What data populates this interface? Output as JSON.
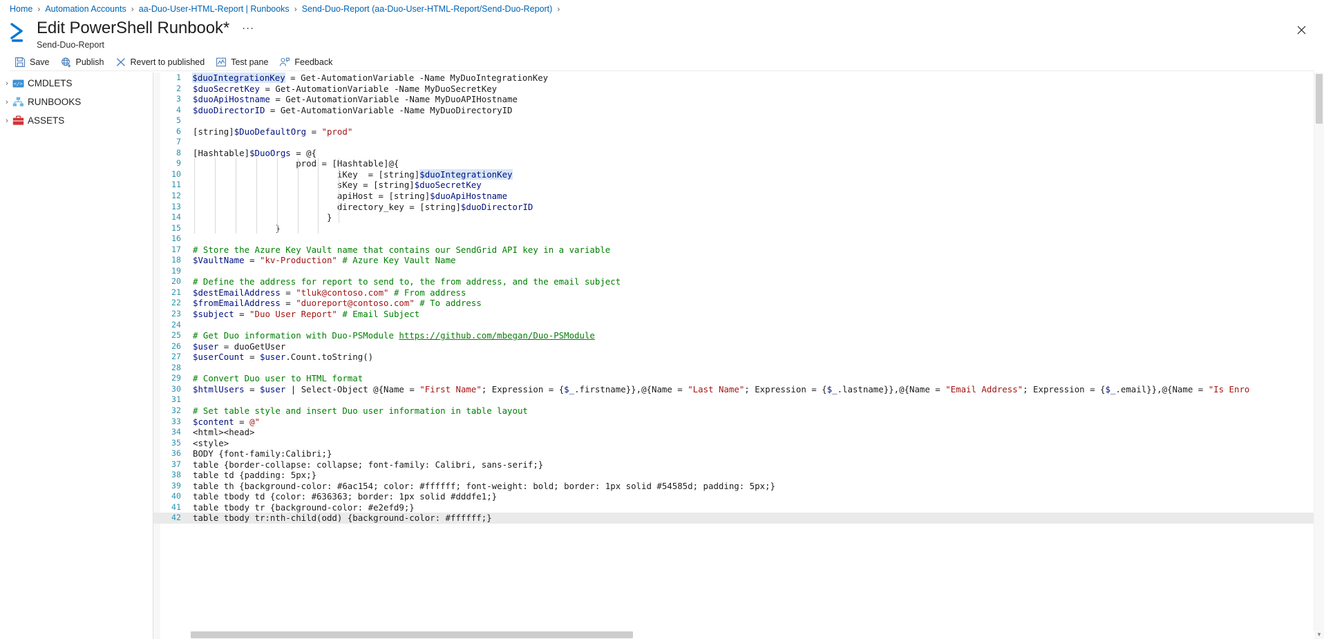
{
  "breadcrumb": {
    "items": [
      {
        "label": "Home",
        "type": "link"
      },
      {
        "label": "Automation Accounts",
        "type": "link"
      },
      {
        "label": "aa-Duo-User-HTML-Report | Runbooks",
        "type": "link"
      },
      {
        "label": "Send-Duo-Report (aa-Duo-User-HTML-Report/Send-Duo-Report)",
        "type": "link"
      }
    ],
    "separator": "›"
  },
  "header": {
    "title": "Edit PowerShell Runbook*",
    "subtitle": "Send-Duo-Report",
    "more_label": "···",
    "close_icon": "close-icon",
    "logo_icon": "powershell-runbook-icon"
  },
  "commandbar": {
    "items": [
      {
        "label": "Save",
        "icon": "save-icon"
      },
      {
        "label": "Publish",
        "icon": "publish-globe-icon"
      },
      {
        "label": "Revert to published",
        "icon": "revert-x-icon"
      },
      {
        "label": "Test pane",
        "icon": "test-pane-icon"
      },
      {
        "label": "Feedback",
        "icon": "feedback-person-icon"
      }
    ]
  },
  "tree": {
    "items": [
      {
        "label": "CMDLETS",
        "icon": "code-brackets-icon",
        "expanded": false,
        "chevron": "›"
      },
      {
        "label": "RUNBOOKS",
        "icon": "hierarchy-icon",
        "expanded": false,
        "chevron": "›"
      },
      {
        "label": "ASSETS",
        "icon": "briefcase-icon",
        "expanded": false,
        "chevron": "›"
      }
    ]
  },
  "editor": {
    "current_line": 42,
    "cursor_line": 1,
    "selection_text": "$duoIntegrationKey",
    "lines": [
      {
        "n": 1,
        "tokens": [
          {
            "t": "var",
            "v": "$duoIntegrationKey",
            "sel": true,
            "caret": true
          },
          {
            "t": "plain",
            "v": " = Get-AutomationVariable -Name MyDuoIntegrationKey"
          }
        ]
      },
      {
        "n": 2,
        "tokens": [
          {
            "t": "var",
            "v": "$duoSecretKey"
          },
          {
            "t": "plain",
            "v": " = Get-AutomationVariable -Name MyDuoSecretKey"
          }
        ]
      },
      {
        "n": 3,
        "tokens": [
          {
            "t": "var",
            "v": "$duoApiHostname"
          },
          {
            "t": "plain",
            "v": " = Get-AutomationVariable -Name MyDuoAPIHostname"
          }
        ]
      },
      {
        "n": 4,
        "tokens": [
          {
            "t": "var",
            "v": "$duoDirectorID"
          },
          {
            "t": "plain",
            "v": " = Get-AutomationVariable -Name MyDuoDirectoryID"
          }
        ]
      },
      {
        "n": 5,
        "tokens": []
      },
      {
        "n": 6,
        "tokens": [
          {
            "t": "plain",
            "v": "[string]"
          },
          {
            "t": "var",
            "v": "$DuoDefaultOrg"
          },
          {
            "t": "plain",
            "v": " = "
          },
          {
            "t": "str",
            "v": "\"prod\""
          }
        ]
      },
      {
        "n": 7,
        "tokens": []
      },
      {
        "n": 8,
        "tokens": [
          {
            "t": "plain",
            "v": "[Hashtable]"
          },
          {
            "t": "var",
            "v": "$DuoOrgs"
          },
          {
            "t": "plain",
            "v": " = @{"
          }
        ]
      },
      {
        "n": 9,
        "tokens": [
          {
            "t": "plain",
            "v": "                    prod = [Hashtable]@{"
          }
        ]
      },
      {
        "n": 10,
        "tokens": [
          {
            "t": "plain",
            "v": "                            iKey  = [string]"
          },
          {
            "t": "var",
            "v": "$duoIntegrationKey",
            "sel": true
          }
        ]
      },
      {
        "n": 11,
        "tokens": [
          {
            "t": "plain",
            "v": "                            sKey = [string]"
          },
          {
            "t": "var",
            "v": "$duoSecretKey"
          }
        ]
      },
      {
        "n": 12,
        "tokens": [
          {
            "t": "plain",
            "v": "                            apiHost = [string]"
          },
          {
            "t": "var",
            "v": "$duoApiHostname"
          }
        ]
      },
      {
        "n": 13,
        "tokens": [
          {
            "t": "plain",
            "v": "                            directory_key = [string]"
          },
          {
            "t": "var",
            "v": "$duoDirectorID"
          }
        ]
      },
      {
        "n": 14,
        "tokens": [
          {
            "t": "plain",
            "v": "                          }"
          }
        ]
      },
      {
        "n": 15,
        "tokens": [
          {
            "t": "plain",
            "v": "                }"
          }
        ]
      },
      {
        "n": 16,
        "tokens": []
      },
      {
        "n": 17,
        "tokens": [
          {
            "t": "com",
            "v": "# Store the Azure Key Vault name that contains our SendGrid API key in a variable"
          }
        ]
      },
      {
        "n": 18,
        "tokens": [
          {
            "t": "var",
            "v": "$VaultName"
          },
          {
            "t": "plain",
            "v": " = "
          },
          {
            "t": "str",
            "v": "\"kv-Production\""
          },
          {
            "t": "plain",
            "v": " "
          },
          {
            "t": "com",
            "v": "# Azure Key Vault Name"
          }
        ]
      },
      {
        "n": 19,
        "tokens": []
      },
      {
        "n": 20,
        "tokens": [
          {
            "t": "com",
            "v": "# Define the address for report to send to, the from address, and the email subject"
          }
        ]
      },
      {
        "n": 21,
        "tokens": [
          {
            "t": "var",
            "v": "$destEmailAddress"
          },
          {
            "t": "plain",
            "v": " = "
          },
          {
            "t": "str",
            "v": "\"tluk@contoso.com\""
          },
          {
            "t": "plain",
            "v": " "
          },
          {
            "t": "com",
            "v": "# From address"
          }
        ]
      },
      {
        "n": 22,
        "tokens": [
          {
            "t": "var",
            "v": "$fromEmailAddress"
          },
          {
            "t": "plain",
            "v": " = "
          },
          {
            "t": "str",
            "v": "\"duoreport@contoso.com\""
          },
          {
            "t": "plain",
            "v": " "
          },
          {
            "t": "com",
            "v": "# To address"
          }
        ]
      },
      {
        "n": 23,
        "tokens": [
          {
            "t": "var",
            "v": "$subject"
          },
          {
            "t": "plain",
            "v": " = "
          },
          {
            "t": "str",
            "v": "\"Duo User Report\""
          },
          {
            "t": "plain",
            "v": " "
          },
          {
            "t": "com",
            "v": "# Email Subject"
          }
        ]
      },
      {
        "n": 24,
        "tokens": []
      },
      {
        "n": 25,
        "tokens": [
          {
            "t": "com",
            "v": "# Get Duo information with Duo-PSModule "
          },
          {
            "t": "url",
            "v": "https://github.com/mbegan/Duo-PSModule"
          }
        ]
      },
      {
        "n": 26,
        "tokens": [
          {
            "t": "var",
            "v": "$user"
          },
          {
            "t": "plain",
            "v": " = duoGetUser"
          }
        ]
      },
      {
        "n": 27,
        "tokens": [
          {
            "t": "var",
            "v": "$userCount"
          },
          {
            "t": "plain",
            "v": " = "
          },
          {
            "t": "var",
            "v": "$user"
          },
          {
            "t": "plain",
            "v": ".Count.toString()"
          }
        ]
      },
      {
        "n": 28,
        "tokens": []
      },
      {
        "n": 29,
        "tokens": [
          {
            "t": "com",
            "v": "# Convert Duo user to HTML format"
          }
        ]
      },
      {
        "n": 30,
        "tokens": [
          {
            "t": "var",
            "v": "$htmlUsers"
          },
          {
            "t": "plain",
            "v": " = "
          },
          {
            "t": "var",
            "v": "$user"
          },
          {
            "t": "plain",
            "v": " | Select-Object @{Name = "
          },
          {
            "t": "str",
            "v": "\"First Name\""
          },
          {
            "t": "plain",
            "v": "; Expression = {"
          },
          {
            "t": "var",
            "v": "$_"
          },
          {
            "t": "plain",
            "v": ".firstname}},@{Name = "
          },
          {
            "t": "str",
            "v": "\"Last Name\""
          },
          {
            "t": "plain",
            "v": "; Expression = {"
          },
          {
            "t": "var",
            "v": "$_"
          },
          {
            "t": "plain",
            "v": ".lastname}},@{Name = "
          },
          {
            "t": "str",
            "v": "\"Email Address\""
          },
          {
            "t": "plain",
            "v": "; Expression = {"
          },
          {
            "t": "var",
            "v": "$_"
          },
          {
            "t": "plain",
            "v": ".email}},@{Name = "
          },
          {
            "t": "str",
            "v": "\"Is Enro"
          }
        ]
      },
      {
        "n": 31,
        "tokens": []
      },
      {
        "n": 32,
        "tokens": [
          {
            "t": "com",
            "v": "# Set table style and insert Duo user information in table layout"
          }
        ]
      },
      {
        "n": 33,
        "tokens": [
          {
            "t": "var",
            "v": "$content"
          },
          {
            "t": "plain",
            "v": " = "
          },
          {
            "t": "str",
            "v": "@\""
          }
        ]
      },
      {
        "n": 34,
        "tokens": [
          {
            "t": "plain",
            "v": "<html><head>"
          }
        ]
      },
      {
        "n": 35,
        "tokens": [
          {
            "t": "plain",
            "v": "<style>"
          }
        ]
      },
      {
        "n": 36,
        "tokens": [
          {
            "t": "plain",
            "v": "BODY {font-family:Calibri;}"
          }
        ]
      },
      {
        "n": 37,
        "tokens": [
          {
            "t": "plain",
            "v": "table {border-collapse: collapse; font-family: Calibri, sans-serif;}"
          }
        ]
      },
      {
        "n": 38,
        "tokens": [
          {
            "t": "plain",
            "v": "table td {padding: 5px;}"
          }
        ]
      },
      {
        "n": 39,
        "tokens": [
          {
            "t": "plain",
            "v": "table th {background-color: #6ac154; color: #ffffff; font-weight: bold; border: 1px solid #54585d; padding: 5px;}"
          }
        ]
      },
      {
        "n": 40,
        "tokens": [
          {
            "t": "plain",
            "v": "table tbody td {color: #636363; border: 1px solid #dddfe1;}"
          }
        ]
      },
      {
        "n": 41,
        "tokens": [
          {
            "t": "plain",
            "v": "table tbody tr {background-color: #e2efd9;}"
          }
        ]
      },
      {
        "n": 42,
        "tokens": [
          {
            "t": "plain",
            "v": "table tbody tr:nth-child(odd) {background-color: #ffffff;}"
          }
        ]
      }
    ]
  },
  "colors": {
    "accent": "#0063b1",
    "comment": "#008000",
    "string": "#a31515",
    "variable": "#001080",
    "gutter": "#2b91af",
    "link": "#0b7d0b"
  }
}
